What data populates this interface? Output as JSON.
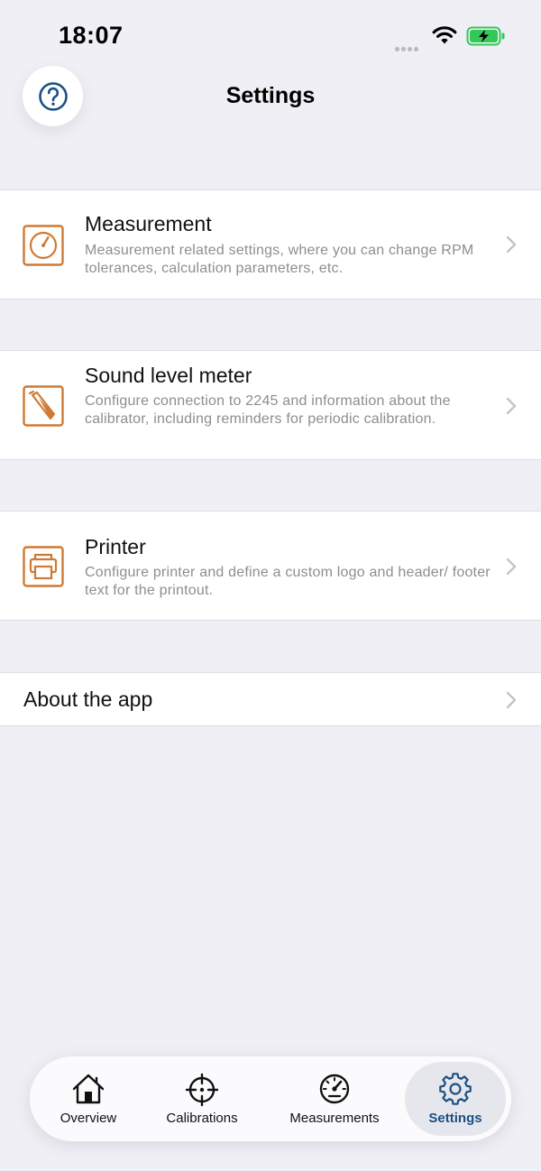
{
  "status_bar": {
    "time": "18:07"
  },
  "header": {
    "title": "Settings",
    "help_icon": "question-circle-icon"
  },
  "settings": [
    {
      "title": "Measurement",
      "description": "Measurement related settings, where you can change RPM tolerances, calculation parameters, etc.",
      "icon": "gauge-icon"
    },
    {
      "title": "Sound level meter",
      "description": "Configure connection to 2245 and information about the calibrator, including reminders for periodic calibration.",
      "icon": "sound-level-meter-icon"
    },
    {
      "title": "Printer",
      "description": "Configure printer and define a custom logo and header/ footer text for the printout.",
      "icon": "printer-icon"
    }
  ],
  "about": {
    "title": "About the app"
  },
  "tabs": [
    {
      "label": "Overview",
      "icon": "house-icon"
    },
    {
      "label": "Calibrations",
      "icon": "crosshair-icon"
    },
    {
      "label": "Measurements",
      "icon": "speedometer-icon"
    },
    {
      "label": "Settings",
      "icon": "gear-icon",
      "active": true
    }
  ],
  "colors": {
    "accent": "#1b4f86",
    "icon_orange": "#cf7a33",
    "background": "#f0eff5"
  }
}
